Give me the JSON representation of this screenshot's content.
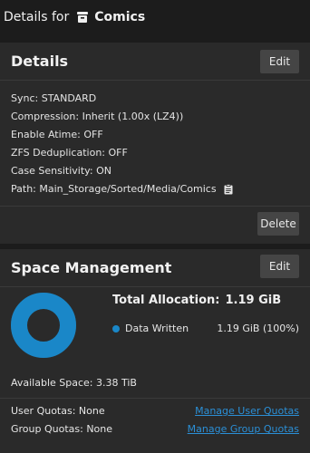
{
  "header": {
    "prefix": "Details for",
    "dataset_icon": "dataset-icon",
    "dataset_name": "Comics"
  },
  "details_card": {
    "title": "Details",
    "edit_label": "Edit",
    "delete_label": "Delete",
    "properties": [
      "Sync: STANDARD",
      "Compression: Inherit (1.00x (LZ4))",
      "Enable Atime: OFF",
      "ZFS Deduplication: OFF",
      "Case Sensitivity: ON",
      "Path: Main_Storage/Sorted/Media/Comics"
    ],
    "copy_icon": "clipboard-icon"
  },
  "space_card": {
    "title": "Space Management",
    "edit_label": "Edit",
    "total_label": "Total Allocation:",
    "total_value": "1.19 GiB",
    "legend": {
      "label": "Data Written",
      "value": "1.19 GiB (100%)",
      "color": "#1a87c8"
    },
    "donut_fraction": 1.0,
    "available_space": "Available Space: 3.38 TiB",
    "user_quotas": "User Quotas: None",
    "user_quotas_link": "Manage User Quotas",
    "group_quotas": "Group Quotas: None",
    "group_quotas_link": "Manage Group Quotas"
  }
}
